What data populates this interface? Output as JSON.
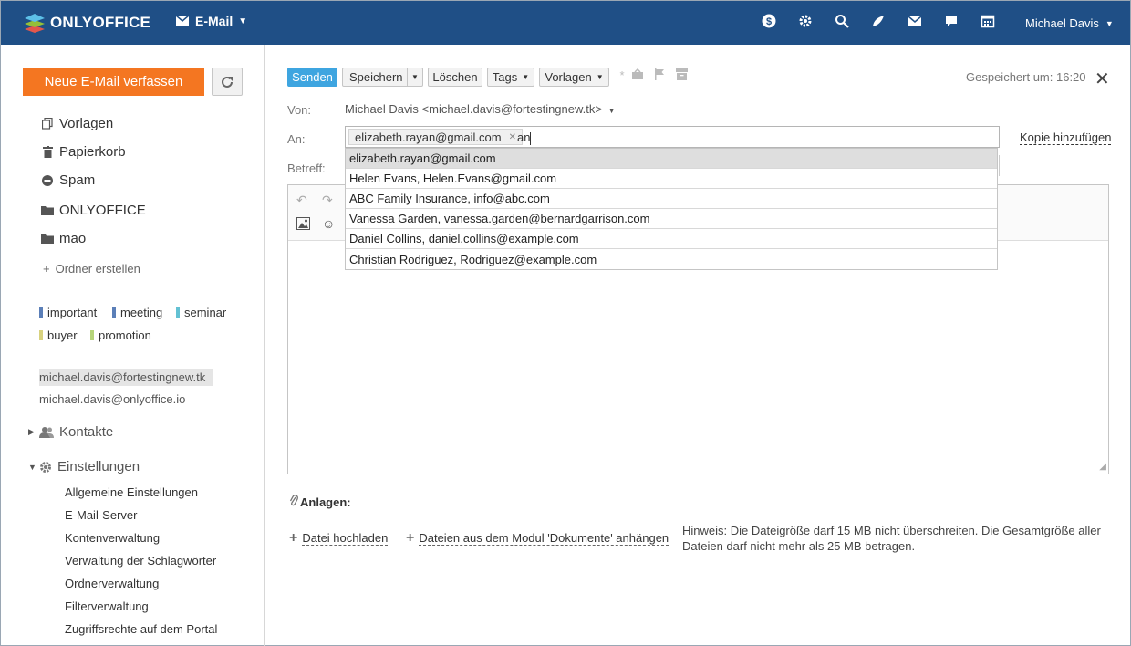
{
  "header": {
    "logo_text": "ONLYOFFICE",
    "module_label": "E-Mail",
    "user_name": "Michael Davis",
    "icons": [
      "talk-icon",
      "settings-icon",
      "search-icon",
      "feed-icon",
      "mail-icon",
      "chat-icon",
      "calendar-icon"
    ]
  },
  "sidebar": {
    "compose_label": "Neue E-Mail verfassen",
    "folders": [
      {
        "label": "Vorlagen",
        "icon": "templates-icon"
      },
      {
        "label": "Papierkorb",
        "icon": "trash-icon"
      },
      {
        "label": "Spam",
        "icon": "spam-icon"
      },
      {
        "label": "ONLYOFFICE",
        "icon": "folder-icon"
      },
      {
        "label": "mao",
        "icon": "folder-icon"
      }
    ],
    "add_folder_label": "Ordner erstellen",
    "tags": [
      {
        "label": "important",
        "color": "#5b7fb8"
      },
      {
        "label": "meeting",
        "color": "#5b7fb8"
      },
      {
        "label": "seminar",
        "color": "#63c1d3"
      },
      {
        "label": "buyer",
        "color": "#d8d27f"
      },
      {
        "label": "promotion",
        "color": "#b6d57a"
      }
    ],
    "accounts": [
      "michael.davis@fortestingnew.tk",
      "michael.davis@onlyoffice.io"
    ],
    "contacts_label": "Kontakte",
    "settings_label": "Einstellungen",
    "settings_items": [
      "Allgemeine Einstellungen",
      "E-Mail-Server",
      "Kontenverwaltung",
      "Verwaltung der Schlagwörter",
      "Ordnerverwaltung",
      "Filterverwaltung",
      "Zugriffsrechte auf dem Portal"
    ]
  },
  "toolbar": {
    "send_label": "Senden",
    "save_label": "Speichern",
    "delete_label": "Löschen",
    "tags_label": "Tags",
    "templates_label": "Vorlagen",
    "saved_text": "Gespeichert um: 16:20"
  },
  "compose": {
    "from_label": "Von:",
    "from_value": "Michael Davis <michael.davis@fortestingnew.tk>",
    "to_label": "An:",
    "to_chip": "elizabeth.rayan@gmail.com",
    "to_typed": "an",
    "subject_label": "Betreff:",
    "add_copy_label": "Kopie hinzufügen"
  },
  "autocomplete": [
    "elizabeth.rayan@gmail.com",
    "Helen Evans, Helen.Evans@gmail.com",
    "ABC Family Insurance, info@abc.com",
    "Vanessa Garden, vanessa.garden@bernardgarrison.com",
    "Daniel Collins, daniel.collins@example.com",
    "Christian Rodriguez, Rodriguez@example.com"
  ],
  "attachments": {
    "title": "Anlagen:",
    "upload_label": "Datei hochladen",
    "attach_docs_label": "Dateien aus dem Modul 'Dokumente' anhängen",
    "hint": "Hinweis: Die Dateigröße darf 15 MB nicht überschreiten. Die Gesamtgröße aller Dateien darf nicht mehr als 25 MB betragen."
  }
}
